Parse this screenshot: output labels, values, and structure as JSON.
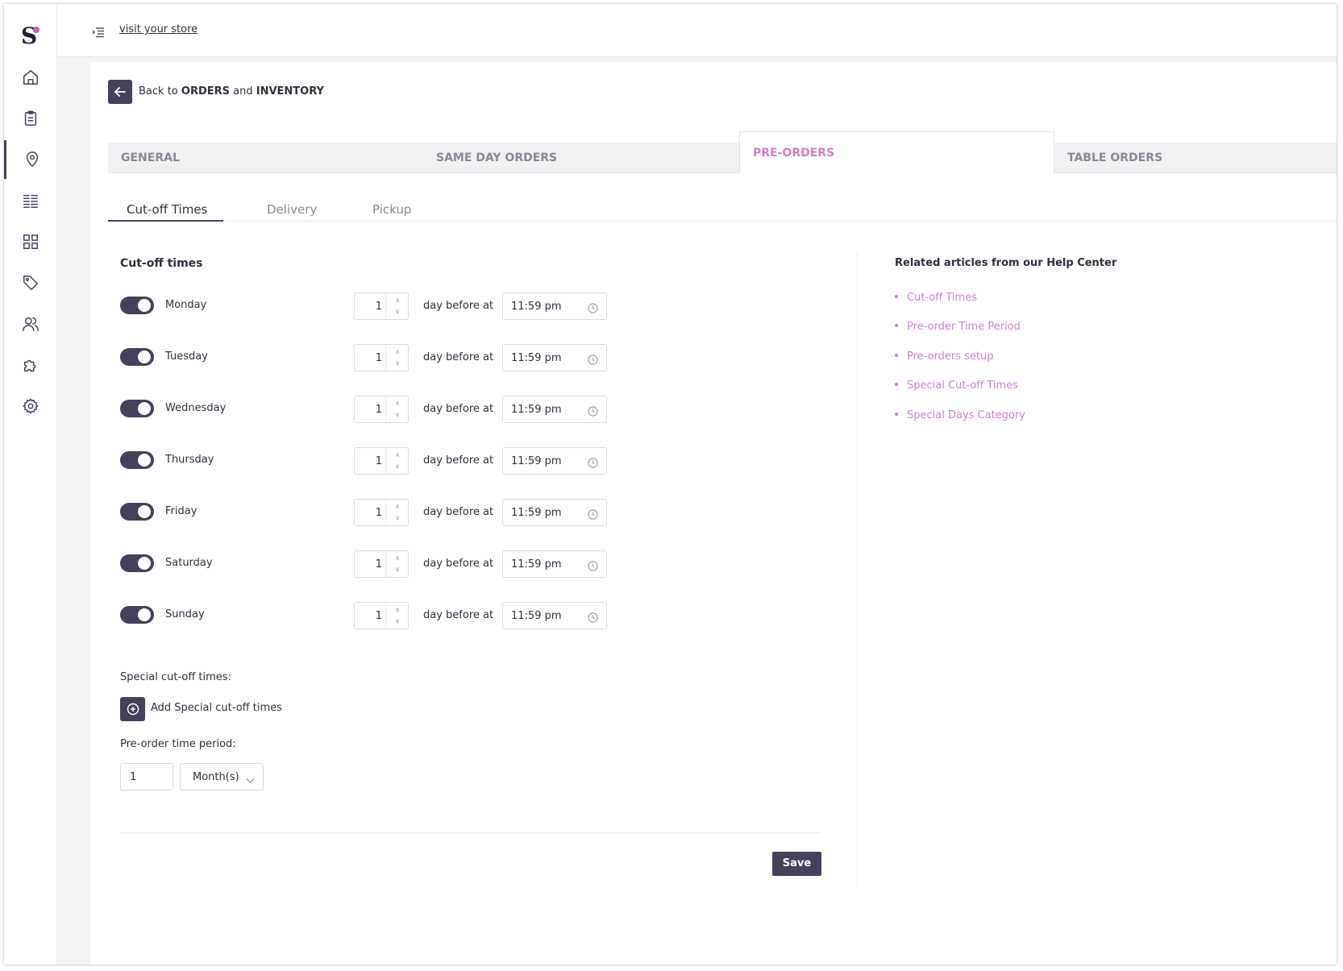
{
  "header": {
    "visit_store": "visit your store"
  },
  "sidebar": {
    "icons": [
      "home-icon",
      "clipboard-icon",
      "location-pin-icon",
      "list-icon",
      "grid-icon",
      "tag-icon",
      "users-icon",
      "puzzle-icon",
      "gear-icon"
    ],
    "active_icon": "location-pin-icon"
  },
  "back": {
    "prefix": "Back to",
    "part1": "ORDERS",
    "joiner": "and",
    "part2": "INVENTORY"
  },
  "tabs": [
    {
      "label": "GENERAL",
      "active": false
    },
    {
      "label": "SAME DAY ORDERS",
      "active": false
    },
    {
      "label": "PRE-ORDERS",
      "active": true
    },
    {
      "label": "TABLE ORDERS",
      "active": false
    }
  ],
  "subtabs": [
    {
      "label": "Cut-off Times",
      "active": true
    },
    {
      "label": "Delivery",
      "active": false
    },
    {
      "label": "Pickup",
      "active": false
    }
  ],
  "cutoff": {
    "title": "Cut-off times",
    "at_label": "day before at",
    "days": [
      {
        "name": "Monday",
        "enabled": true,
        "days_before": "1",
        "time": "11:59 pm"
      },
      {
        "name": "Tuesday",
        "enabled": true,
        "days_before": "1",
        "time": "11:59 pm"
      },
      {
        "name": "Wednesday",
        "enabled": true,
        "days_before": "1",
        "time": "11:59 pm"
      },
      {
        "name": "Thursday",
        "enabled": true,
        "days_before": "1",
        "time": "11:59 pm"
      },
      {
        "name": "Friday",
        "enabled": true,
        "days_before": "1",
        "time": "11:59 pm"
      },
      {
        "name": "Saturday",
        "enabled": true,
        "days_before": "1",
        "time": "11:59 pm"
      },
      {
        "name": "Sunday",
        "enabled": true,
        "days_before": "1",
        "time": "11:59 pm"
      }
    ]
  },
  "special": {
    "label": "Special cut-off times:",
    "add_label": "Add Special cut-off times"
  },
  "period": {
    "label": "Pre-order time period:",
    "value": "1",
    "unit": "Month(s)"
  },
  "save_label": "Save",
  "help": {
    "title": "Related articles from our Help Center",
    "links": [
      "Cut-off Times",
      "Pre-order Time Period",
      "Pre-orders setup",
      "Special Cut-off Times",
      "Special Days Category"
    ]
  },
  "colors": {
    "primary": "#44425a",
    "accent": "#d27bd3",
    "logo_dot": "#c85ab8"
  }
}
